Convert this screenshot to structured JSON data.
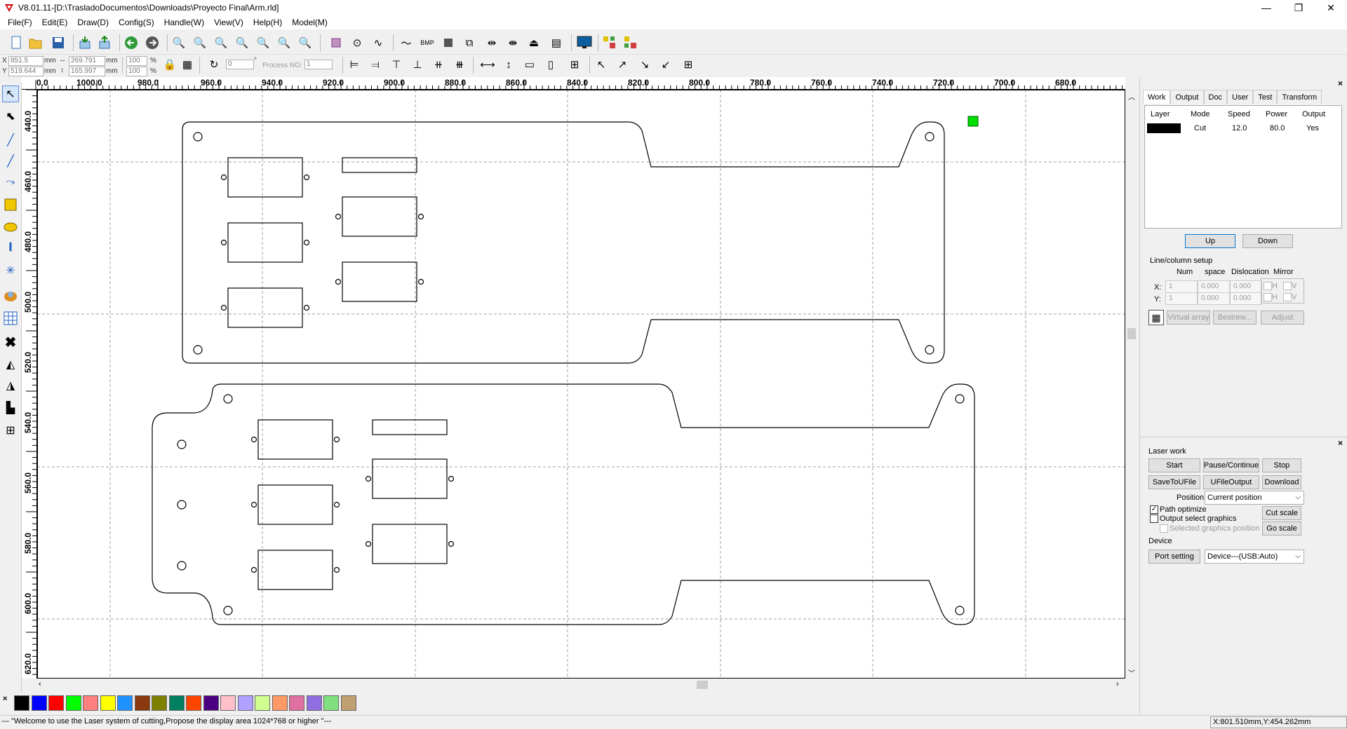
{
  "window": {
    "title": "V8.01.11-[D:\\TrasladoDocumentos\\Downloads\\Proyecto Final\\Arm.rld]",
    "min": "—",
    "max": "❐",
    "close": "✕"
  },
  "menu": [
    "File(F)",
    "Edit(E)",
    "Draw(D)",
    "Config(S)",
    "Handle(W)",
    "View(V)",
    "Help(H)",
    "Model(M)"
  ],
  "toolbar2": {
    "x_label": "X",
    "y_label": "Y",
    "x_value": "851.5",
    "y_value": "519.644",
    "unit": "mm",
    "width_value": "269.791",
    "height_value": "165.997",
    "scale_x": "100",
    "scale_y": "100",
    "percent": "%",
    "rotate_value": "0",
    "degree": "°",
    "process_no_label": "Process NO:",
    "process_no_value": "1"
  },
  "ruler_h": [
    "0.0",
    "1000.0",
    "980.0",
    "960.0",
    "940.0",
    "920.0",
    "900.0",
    "880.0",
    "860.0",
    "840.0",
    "820.0",
    "800.0",
    "780.0",
    "760.0",
    "740.0",
    "720.0",
    "700.0",
    "680.0"
  ],
  "ruler_v": [
    "440.0",
    "460.0",
    "480.0",
    "500.0",
    "520.0",
    "540.0",
    "560.0",
    "580.0",
    "600.0",
    "620.0"
  ],
  "palette_close": "×",
  "colors": [
    "#000000",
    "#0000ff",
    "#ff0000",
    "#00ff00",
    "#ff8080",
    "#ffff00",
    "#1e90ff",
    "#8b3a0f",
    "#808000",
    "#008060",
    "#ff4500",
    "#4b0082",
    "#ffc0cb",
    "#b0a0ff",
    "#d0ff90",
    "#ff9966",
    "#e070a0",
    "#9070e0",
    "#80e080",
    "#c0a070"
  ],
  "status": {
    "message": "--- \"Welcome to use the Laser system of cutting,Propose the display area 1024*768 or higher \"---",
    "coords": "X:801.510mm,Y:454.262mm"
  },
  "panel": {
    "close": "×",
    "tabs": [
      "Work",
      "Output",
      "Doc",
      "User",
      "Test",
      "Transform"
    ],
    "layer_headers": [
      "Layer",
      "Mode",
      "Speed",
      "Power",
      "Output"
    ],
    "layer_row": {
      "color": "#000000",
      "mode": "Cut",
      "speed": "12.0",
      "power": "80.0",
      "output": "Yes"
    },
    "up": "Up",
    "down": "Down",
    "line_column_title": "Line/column setup",
    "lc_headers": [
      "Num",
      "space",
      "Dislocation",
      "Mirror"
    ],
    "lc_x_label": "X:",
    "lc_y_label": "Y:",
    "x_num": "1",
    "x_space": "0.000",
    "x_disloc": "0.000",
    "y_num": "1",
    "y_space": "0.000",
    "y_disloc": "0.000",
    "mirror_h": "H",
    "mirror_v": "V",
    "virtual_array": "Virtual array",
    "bestrew": "Bestrew...",
    "adjust": "Adjust"
  },
  "laser": {
    "close": "×",
    "title": "Laser work",
    "start": "Start",
    "pause": "Pause/Continue",
    "stop": "Stop",
    "save_u": "SaveToUFile",
    "ufile_output": "UFileOutput",
    "download": "Download",
    "position_label": "Position:",
    "position_value": "Current position",
    "path_optimize": "Path optimize",
    "output_select": "Output select graphics",
    "selected_pos": "Selected graphics position",
    "cut_scale": "Cut scale",
    "go_scale": "Go scale",
    "device_title": "Device",
    "port_setting": "Port setting",
    "device_value": "Device---(USB:Auto)"
  }
}
